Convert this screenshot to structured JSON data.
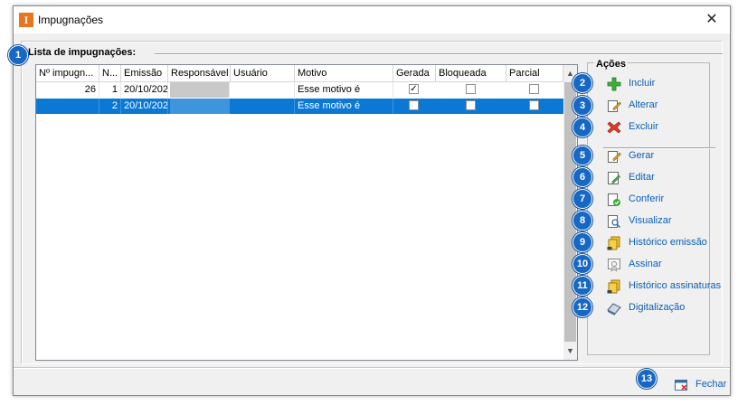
{
  "window": {
    "title": "Impugnações",
    "icon_letter": "I",
    "close_glyph": "✕"
  },
  "group": {
    "label": "Lista de impugnações:"
  },
  "grid": {
    "columns": [
      "Nº impugn...",
      "N...",
      "Emissão",
      "Responsável",
      "Usuário",
      "Motivo",
      "Gerada",
      "Bloqueada",
      "Parcial"
    ],
    "rows": [
      {
        "numero": "26",
        "n": "1",
        "emissao": "20/10/202",
        "responsavel": "",
        "usuario": "",
        "motivo": "Esse motivo é",
        "gerada": true,
        "bloqueada": false,
        "parcial": false,
        "selected": false
      },
      {
        "numero": "",
        "n": "2",
        "emissao": "20/10/202",
        "responsavel": "",
        "usuario": "",
        "motivo": "Esse motivo é",
        "gerada": false,
        "bloqueada": false,
        "parcial": false,
        "selected": true
      }
    ]
  },
  "actions": {
    "title": "Ações",
    "items": [
      {
        "badge": "2",
        "label": "Incluir",
        "icon": "plus-icon"
      },
      {
        "badge": "3",
        "label": "Alterar",
        "icon": "edit-icon"
      },
      {
        "badge": "4",
        "label": "Excluir",
        "icon": "delete-icon"
      },
      {
        "badge": "5",
        "label": "Gerar",
        "icon": "generate-icon"
      },
      {
        "badge": "6",
        "label": "Editar",
        "icon": "edit-doc-icon"
      },
      {
        "badge": "7",
        "label": "Conferir",
        "icon": "check-doc-icon"
      },
      {
        "badge": "8",
        "label": "Visualizar",
        "icon": "preview-icon"
      },
      {
        "badge": "9",
        "label": "Histórico emissão",
        "icon": "history-icon"
      },
      {
        "badge": "10",
        "label": "Assinar",
        "icon": "sign-icon"
      },
      {
        "badge": "11",
        "label": "Histórico assinaturas",
        "icon": "history-signatures-icon"
      },
      {
        "badge": "12",
        "label": "Digitalização",
        "icon": "scanner-icon"
      }
    ]
  },
  "footer": {
    "close_label": "Fechar",
    "badge": "13"
  },
  "badges": {
    "list": "1"
  },
  "colors": {
    "badge": "#1668c4",
    "link": "#0a5fb7",
    "selection": "#0a78d4",
    "app_icon": "#e8761e"
  }
}
